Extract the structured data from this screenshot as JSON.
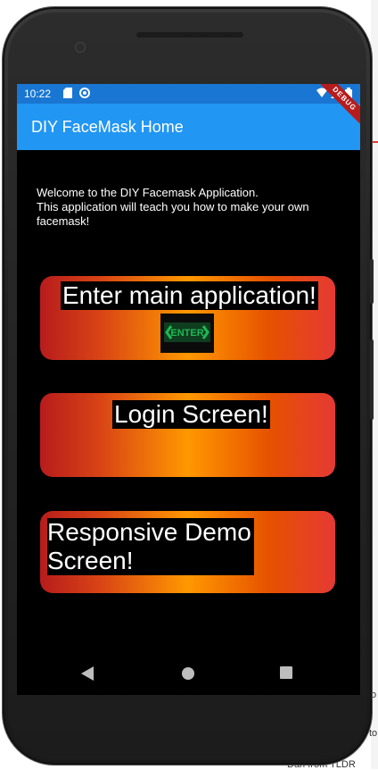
{
  "background": {
    "text_1": "o",
    "text_2": "to",
    "text_3": "Dan from TLDR"
  },
  "status_bar": {
    "time": "10:22",
    "debug_label": "DEBUG"
  },
  "appbar": {
    "title": "DIY FaceMask Home"
  },
  "welcome": {
    "line1": "Welcome to the DIY Facemask Application.",
    "line2": "This application will teach you how to make your own facemask!"
  },
  "buttons": [
    {
      "label": "Enter main application!",
      "badge": "ENTER"
    },
    {
      "label": "Login Screen!"
    },
    {
      "label": "Responsive Demo Screen!"
    }
  ],
  "colors": {
    "appbar": "#2196f3",
    "status_bar": "#1976d2",
    "gradient": [
      "#b71c1c",
      "#ff9800",
      "#e53935"
    ],
    "enter_sign": "#1db954"
  },
  "navbar": {
    "icons": [
      "back-icon",
      "home-icon",
      "recents-icon"
    ]
  }
}
